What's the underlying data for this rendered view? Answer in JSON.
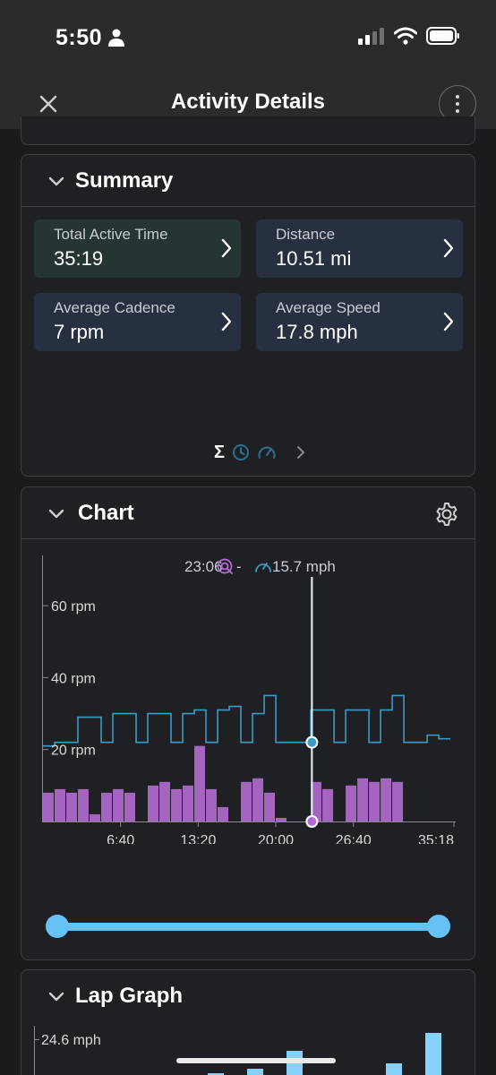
{
  "status_bar": {
    "time": "5:50",
    "icons": [
      "person-icon",
      "signal-icon",
      "wifi-icon",
      "battery-icon"
    ]
  },
  "nav": {
    "title": "Activity Details",
    "close_icon": "close-icon",
    "more_icon": "more-vertical-icon"
  },
  "summary": {
    "title": "Summary",
    "tiles": [
      {
        "label": "Total Active Time",
        "value": "35:19"
      },
      {
        "label": "Distance",
        "value": "10.51 mi"
      },
      {
        "label": "Average Cadence",
        "value": "7 rpm"
      },
      {
        "label": "Average Speed",
        "value": "17.8 mph"
      }
    ],
    "pager": {
      "sigma": "Σ",
      "icons": [
        "clock-icon",
        "speedometer-icon"
      ],
      "next_icon": "chevron-right-icon"
    }
  },
  "chart": {
    "title": "Chart",
    "cursor": {
      "time": "23:06",
      "cadence": "-",
      "speed": "15.7 mph"
    },
    "colors": {
      "speed": "#3d9ac5",
      "cadence": "#b46bd1",
      "cursor": "#d8e8ee",
      "slider": "#66c1f5"
    },
    "chart_data": {
      "type": "line",
      "x_ticks": [
        "6:40",
        "13:20",
        "20:00",
        "26:40",
        "35:18"
      ],
      "y_ticks": [
        "20 rpm",
        "40 rpm",
        "60 rpm"
      ],
      "xlim": [
        0,
        2118
      ],
      "ylim": [
        0,
        66
      ],
      "series": [
        {
          "x": [
            0,
            60,
            120,
            180,
            240,
            300,
            360,
            420,
            480,
            540,
            600,
            660,
            720,
            780,
            840,
            900,
            960,
            1020,
            1080,
            1140,
            1200,
            1260,
            1320,
            1380,
            1440,
            1500,
            1560,
            1620,
            1680,
            1740,
            1800,
            1860,
            1920,
            1980,
            2040,
            2100
          ],
          "y": [
            21,
            22,
            22,
            29,
            29,
            22,
            30,
            30,
            22,
            30,
            30,
            22,
            30,
            31,
            22,
            31,
            32,
            22,
            30,
            35,
            22,
            22,
            22,
            31,
            31,
            22,
            31,
            31,
            22,
            31,
            35,
            22,
            22,
            24,
            23,
            23
          ]
        },
        {
          "x": [
            0,
            60,
            120,
            180,
            240,
            300,
            360,
            420,
            480,
            540,
            600,
            660,
            720,
            780,
            840,
            900,
            960,
            1020,
            1080,
            1140,
            1200,
            1260,
            1320,
            1380,
            1440,
            1500,
            1560,
            1620,
            1680,
            1740,
            1800,
            1860,
            1920,
            1980,
            2040,
            2100
          ],
          "y": [
            8,
            9,
            8,
            9,
            2,
            8,
            9,
            8,
            0,
            10,
            11,
            9,
            10,
            21,
            9,
            4,
            0,
            11,
            12,
            8,
            1,
            0,
            0,
            11,
            9,
            0,
            10,
            12,
            11,
            12,
            11,
            0,
            0,
            0,
            0,
            0
          ]
        }
      ]
    }
  },
  "lap": {
    "title": "Lap Graph",
    "y_tick": "24.6 mph"
  }
}
